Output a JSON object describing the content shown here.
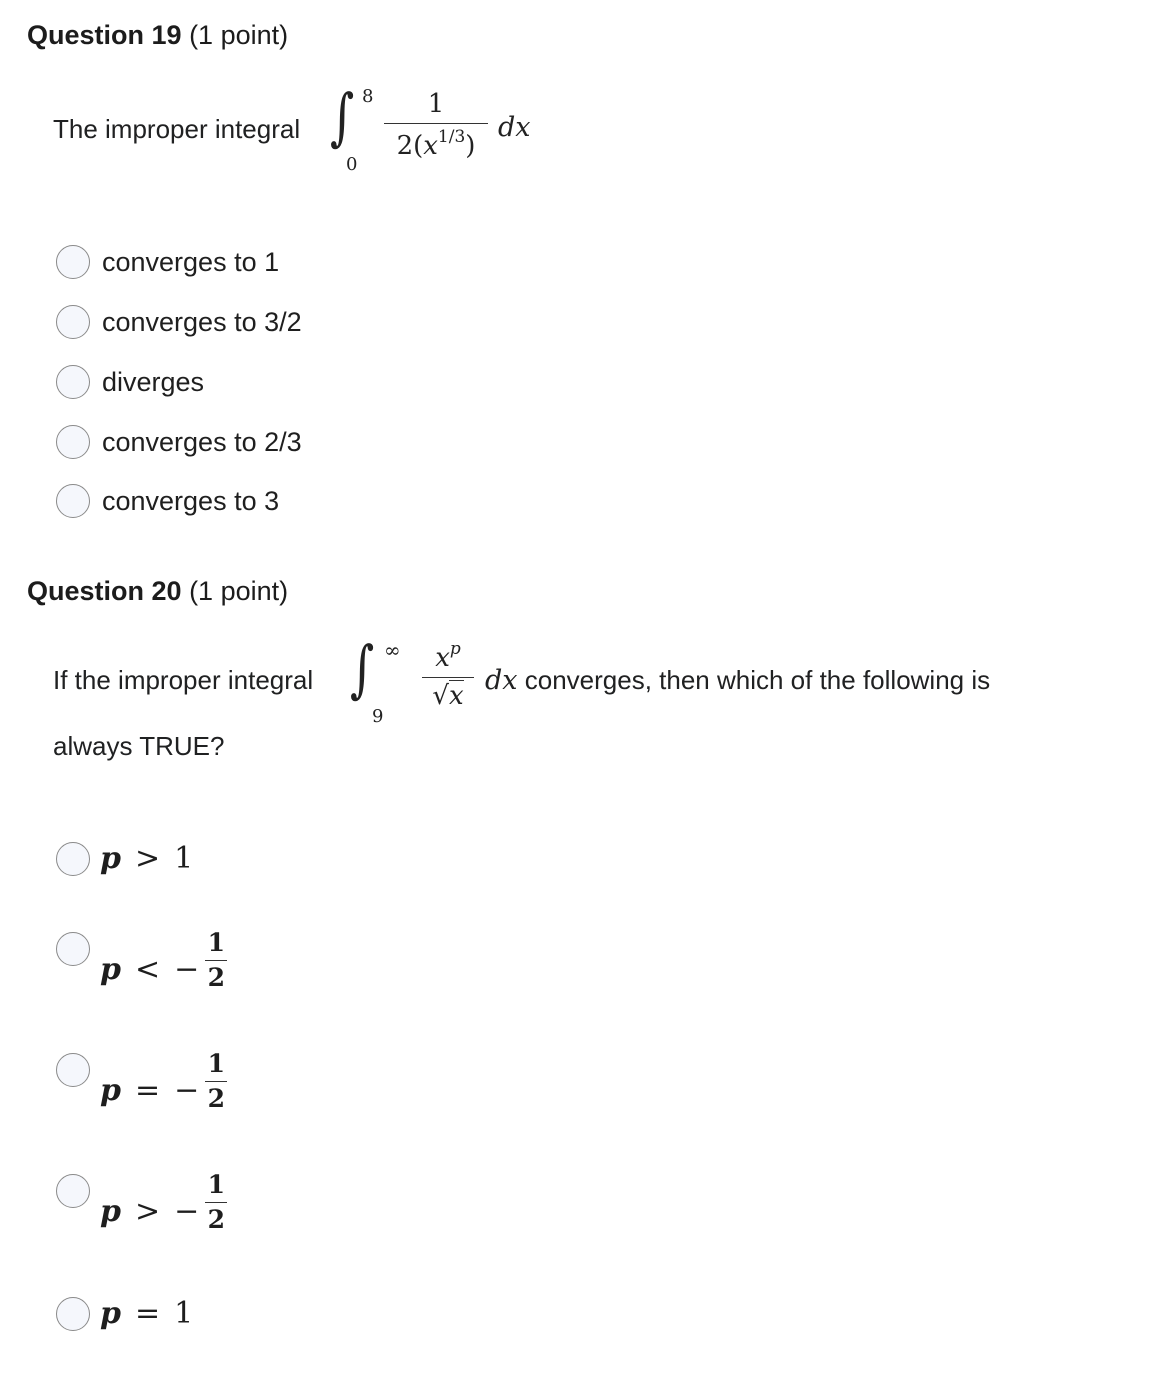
{
  "questions": [
    {
      "title": "Question 19",
      "points": "(1 point)",
      "stem_prefix": "The improper integral",
      "integral": {
        "lower": "0",
        "upper": "8",
        "numerator": "1",
        "denominator_coef": "2(",
        "denominator_var": "x",
        "denominator_exp": "1/3",
        "denominator_close": ")",
        "differential": "dx"
      },
      "options": [
        {
          "label": "converges to 1"
        },
        {
          "label": "converges to 3/2"
        },
        {
          "label": "diverges"
        },
        {
          "label": "converges to 2/3"
        },
        {
          "label": "converges to 3"
        }
      ]
    },
    {
      "title": "Question 20",
      "points": "(1 point)",
      "stem_prefix": "If the improper integral",
      "stem_suffix": "converges, then which of the following is",
      "stem_line2": "always TRUE?",
      "integral": {
        "lower": "9",
        "upper": "∞",
        "numerator_var": "x",
        "numerator_exp": "p",
        "denominator_sqrt": "√",
        "denominator_var": "x",
        "differential": "dx"
      },
      "options": [
        {
          "var": "p",
          "rel": ">",
          "sign": "",
          "value": "1"
        },
        {
          "var": "p",
          "rel": "<",
          "sign": "−",
          "num": "1",
          "den": "2"
        },
        {
          "var": "p",
          "rel": "=",
          "sign": "−",
          "num": "1",
          "den": "2"
        },
        {
          "var": "p",
          "rel": ">",
          "sign": "−",
          "num": "1",
          "den": "2"
        },
        {
          "var": "p",
          "rel": "=",
          "sign": "",
          "value": "1"
        }
      ]
    }
  ]
}
